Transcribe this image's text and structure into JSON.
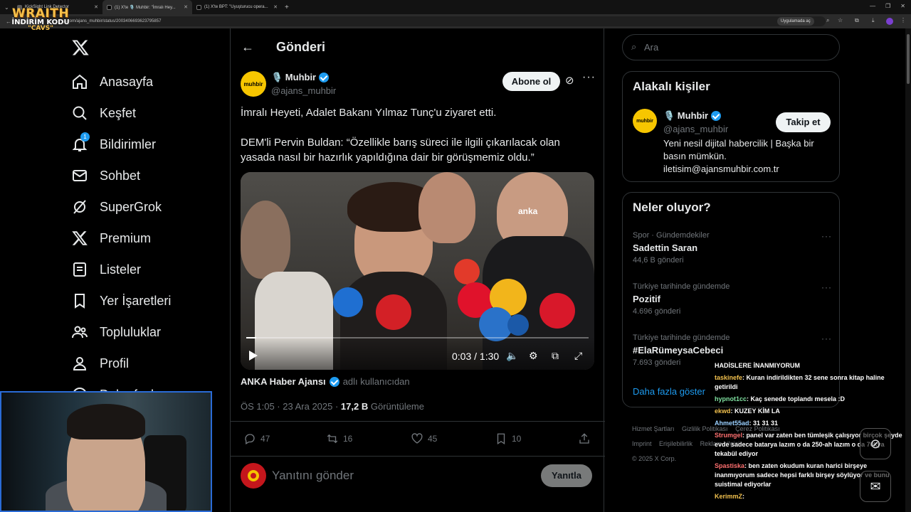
{
  "browser": {
    "tabs": [
      {
        "label": "KickSight Link Detector"
      },
      {
        "label": "(1) X'te 🎙️ Muhbir: \"İmralı Hey..."
      },
      {
        "label": "(1) X'te BPT: \"Uyuşturucu opera..."
      }
    ],
    "url": "x.com/ajans_muhbir/status/2003406693623795857",
    "open_in_app": "Uygulamada aç"
  },
  "overlay_brand": {
    "title": "WRAITH",
    "line2": "İNDİRİM KODU",
    "line3": "\"CAVS\""
  },
  "nav": {
    "items": [
      {
        "label": "Anasayfa",
        "icon": "home-icon"
      },
      {
        "label": "Keşfet",
        "icon": "search-icon"
      },
      {
        "label": "Bildirimler",
        "icon": "bell-icon",
        "badge": "1"
      },
      {
        "label": "Sohbet",
        "icon": "mail-icon"
      },
      {
        "label": "SuperGrok",
        "icon": "grok-icon"
      },
      {
        "label": "Premium",
        "icon": "x-icon"
      },
      {
        "label": "Listeler",
        "icon": "list-icon"
      },
      {
        "label": "Yer İşaretleri",
        "icon": "bookmark-icon"
      },
      {
        "label": "Topluluklar",
        "icon": "people-icon"
      },
      {
        "label": "Profil",
        "icon": "person-icon"
      },
      {
        "label": "Daha fazla",
        "icon": "more-icon"
      }
    ]
  },
  "post": {
    "header_title": "Gönderi",
    "author_name": "🎙️ Muhbir",
    "author_handle": "@ajans_muhbir",
    "avatar_text": "muhbir",
    "subscribe_label": "Abone ol",
    "text_line1": "İmralı Heyeti, Adalet Bakanı Yılmaz Tunç'u ziyaret etti.",
    "text_line2": "DEM'li Pervin Buldan: “Özellikle barış süreci ile ilgili çıkarılacak olan yasada nasıl bir hazırlık yapıldığına dair bir görüşmemiz oldu.”",
    "video": {
      "time": "0:03 / 1:30",
      "watermark": "anka",
      "progress": 0.03
    },
    "source_name": "ANKA Haber Ajansı",
    "source_suffix": "adlı kullanıcıdan",
    "timestamp": "ÖS 1:05 · 23 Ara 2025 · ",
    "views_count": "17,2 B",
    "views_label": " Görüntüleme",
    "stats": {
      "replies": "47",
      "reposts": "16",
      "likes": "45",
      "bookmarks": "10"
    },
    "reply_placeholder": "Yanıtını gönder",
    "reply_button": "Yanıtla"
  },
  "sidebar": {
    "search_placeholder": "Ara",
    "related_title": "Alakalı kişiler",
    "related_user": {
      "name": "🎙️ Muhbir",
      "handle": "@ajans_muhbir",
      "avatar_text": "muhbir",
      "follow_label": "Takip et",
      "bio": "Yeni nesil dijital habercilik | Başka bir basın mümkün. iletisim@ajansmuhbir.com.tr"
    },
    "trends_title": "Neler oluyor?",
    "trends": [
      {
        "context": "Spor · Gündemdekiler",
        "name": "Sadettin Saran",
        "posts": "44,6 B gönderi"
      },
      {
        "context": "Türkiye tarihinde gündemde",
        "name": "Pozitif",
        "posts": "4.696 gönderi"
      },
      {
        "context": "Türkiye tarihinde gündemde",
        "name": "#ElaRümeysaCebeci",
        "posts": "7.693 gönderi"
      }
    ],
    "show_more": "Daha fazla göster",
    "footer": [
      "Hizmet Şartları",
      "Gizlilik Politikası",
      "Çerez Politikası",
      "Imprint",
      "Erişilebilirlik",
      "Reklam bilgisi",
      "© 2025 X Corp."
    ]
  },
  "stream_chat": [
    {
      "user": "",
      "text": "HADİSLERE İNANMIYORUM",
      "color": "#ffffff"
    },
    {
      "user": "taskinefe",
      "text": ": Kuran indirildikten 32 sene sonra kitap haline getirildi",
      "color": "#f2c14e"
    },
    {
      "user": "hypnot1cc",
      "text": ": Kaç senede toplandı mesela :D",
      "color": "#7fe0a0"
    },
    {
      "user": "ekwd",
      "text": ": KUZEY KİM LA",
      "color": "#f2c14e"
    },
    {
      "user": "Ahmet55ad",
      "text": ": 31 31 31",
      "color": "#9ad0ff"
    },
    {
      "user": "Strumgel",
      "text": ": panel var zaten ben tümleşik çalışıyor birçok şeyde evde sadece batarya lazım o da 250-ah lazım o da 70kya tekabül ediyor",
      "color": "#ff7070"
    },
    {
      "user": "Spastiska",
      "text": ": ben zaten okudum kuran harici birşeye inanmıyorum sadece hepsi farklı birşey söylüyor ve bunu suistimal ediyorlar",
      "color": "#ff7070"
    },
    {
      "user": "KerimmZ",
      "text": ": ",
      "color": "#f2c14e"
    }
  ],
  "colors": {
    "accent": "#1d9bf0",
    "background": "#000000",
    "muted": "#71767b",
    "border": "#2f3336"
  }
}
